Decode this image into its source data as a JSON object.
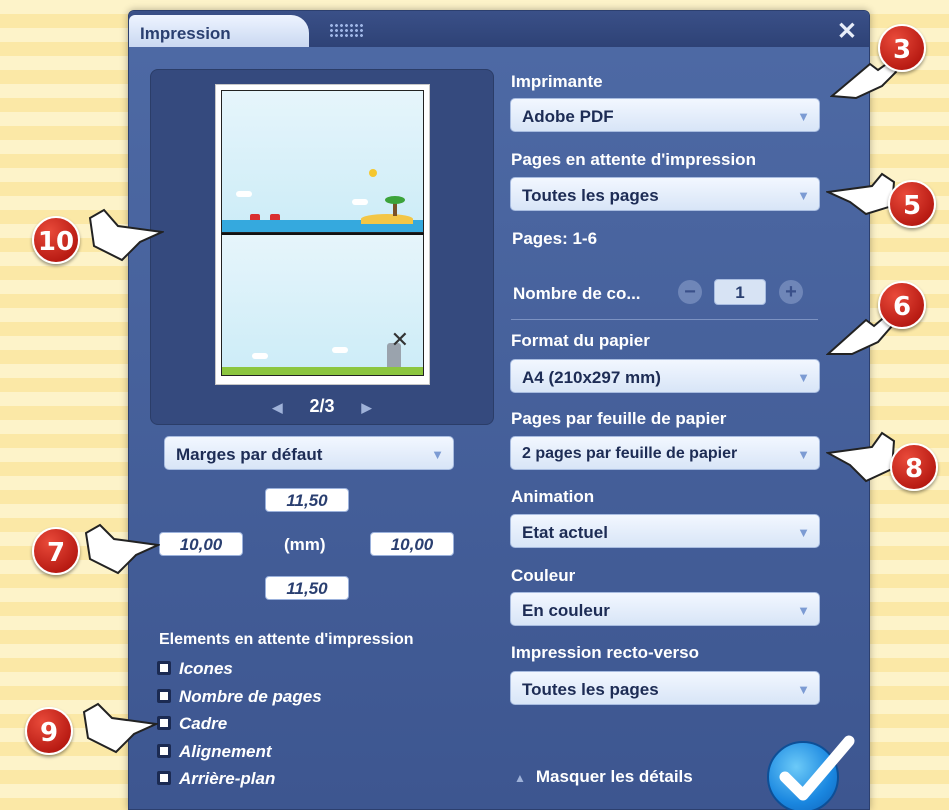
{
  "dialog": {
    "title": "Impression",
    "close_label": "✕"
  },
  "preview": {
    "page_indicator": "2/3",
    "prev": "◀",
    "next": "▶"
  },
  "margins": {
    "select_label": "Marges par défaut",
    "top": "11,50",
    "left": "10,00",
    "right": "10,00",
    "bottom": "11,50",
    "unit": "(mm)"
  },
  "elements": {
    "heading": "Elements en attente d'impression",
    "items": [
      "Icones",
      "Nombre de pages",
      "Cadre",
      "Alignement",
      "Arrière-plan"
    ]
  },
  "printer": {
    "label": "Imprimante",
    "value": "Adobe PDF"
  },
  "pages": {
    "label": "Pages en attente d'impression",
    "value": "Toutes les pages",
    "range": "Pages: 1-6"
  },
  "copies": {
    "label": "Nombre de co...",
    "value": "1",
    "minus": "−",
    "plus": "+"
  },
  "paper_format": {
    "label": "Format du papier",
    "value": "A4 (210x297 mm)"
  },
  "pages_per_sheet": {
    "label": "Pages par feuille de papier",
    "value": "2 pages par feuille de papier"
  },
  "animation": {
    "label": "Animation",
    "value": "Etat actuel"
  },
  "color": {
    "label": "Couleur",
    "value": "En couleur"
  },
  "duplex": {
    "label": "Impression recto-verso",
    "value": "Toutes les pages"
  },
  "footer": {
    "hide_details": "Masquer les détails"
  },
  "callouts": [
    "3",
    "5",
    "6",
    "7",
    "8",
    "9",
    "10"
  ],
  "colors": {
    "accent": "#1a87e0",
    "callout": "#c81f14",
    "dialog_bg": "#4e6aa5"
  }
}
